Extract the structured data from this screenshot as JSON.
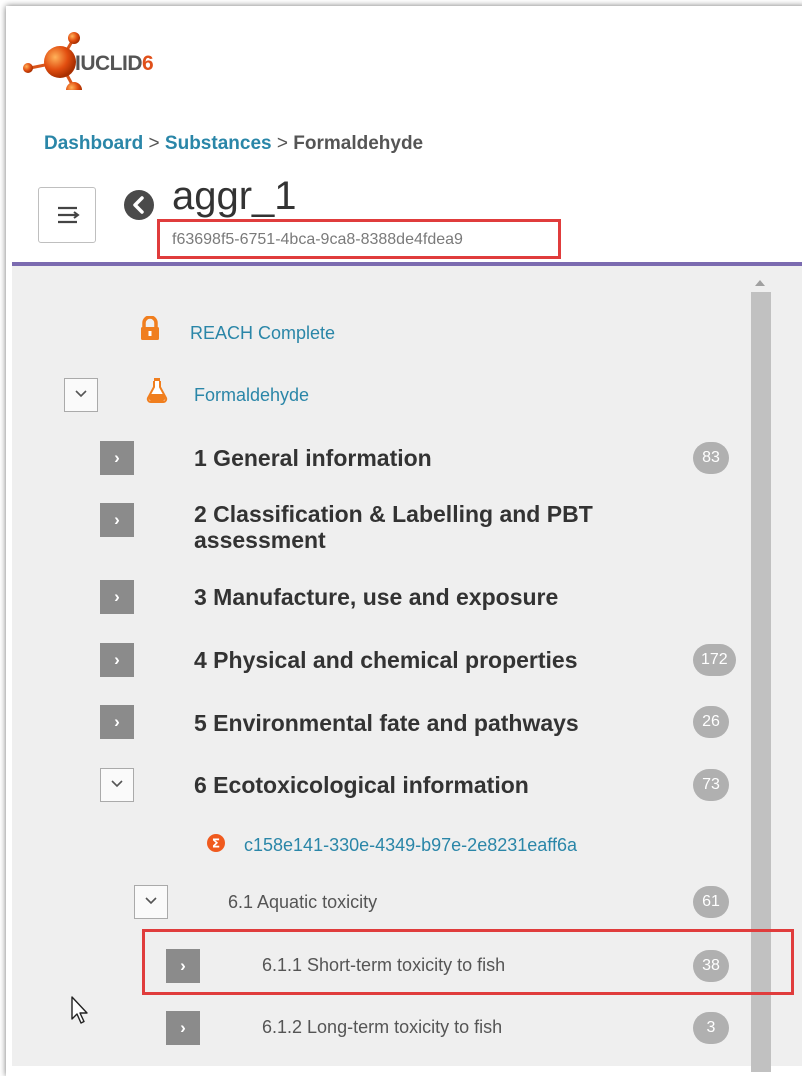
{
  "app": {
    "logo_text": "IUCLID",
    "logo_version": "6"
  },
  "breadcrumb": {
    "items": [
      "Dashboard",
      "Substances",
      "Formaldehyde"
    ],
    "separator": ">"
  },
  "header": {
    "title": "aggr_1",
    "uuid": "f63698f5-6751-4bca-9ca8-8388de4fdea9"
  },
  "tree": {
    "dossier": {
      "label": "REACH Complete",
      "icon": "lock-icon"
    },
    "substance": {
      "label": "Formaldehyde",
      "icon": "flask-icon"
    },
    "sections": [
      {
        "label": "1 General information",
        "count": "83"
      },
      {
        "label": "2 Classification & Labelling and PBT assessment",
        "count": ""
      },
      {
        "label": "3 Manufacture, use and exposure",
        "count": ""
      },
      {
        "label": "4 Physical and chemical properties",
        "count": "172"
      },
      {
        "label": "5 Environmental fate and pathways",
        "count": "26"
      },
      {
        "label": "6 Ecotoxicological information",
        "count": "73"
      }
    ],
    "summary_record": {
      "label": "c158e141-330e-4349-b97e-2e8231eaff6a",
      "icon": "sigma-icon"
    },
    "subsection": {
      "label": "6.1 Aquatic toxicity",
      "count": "61"
    },
    "endpoints": [
      {
        "label": "6.1.1 Short-term toxicity to fish",
        "count": "38"
      },
      {
        "label": "6.1.2 Long-term toxicity to fish",
        "count": "3"
      }
    ]
  },
  "colors": {
    "accent_link": "#2a86a8",
    "highlight_red": "#e03c3c",
    "divider_purple": "#7b6bb0",
    "logo_orange": "#e0501a"
  }
}
